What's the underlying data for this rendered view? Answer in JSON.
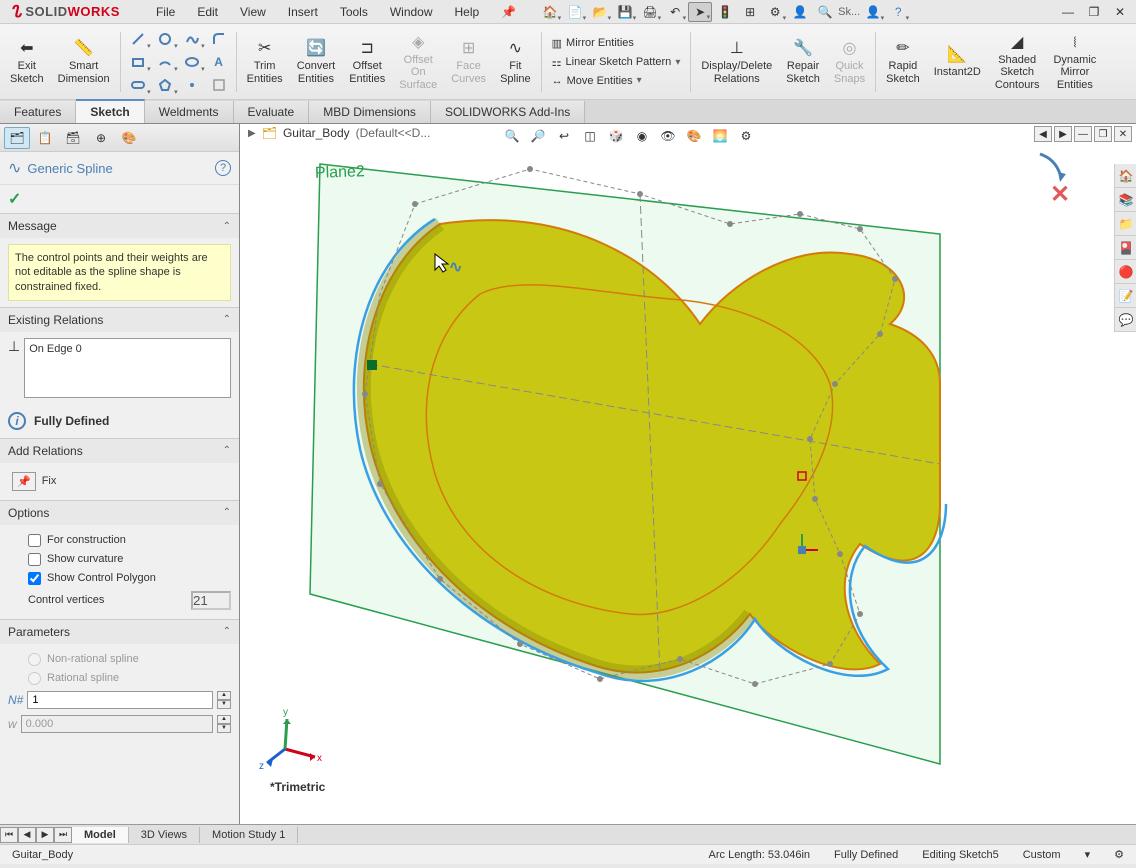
{
  "app": {
    "brand_solid": "SOLID",
    "brand_works": "WORKS",
    "brand_ds": "DS"
  },
  "menu": {
    "file": "File",
    "edit": "Edit",
    "view": "View",
    "insert": "Insert",
    "tools": "Tools",
    "window": "Window",
    "help": "Help"
  },
  "search_label": "Sk...",
  "ribbon": {
    "exit_sketch": "Exit\nSketch",
    "smart_dim": "Smart\nDimension",
    "trim": "Trim\nEntities",
    "convert": "Convert\nEntities",
    "offset": "Offset\nEntities",
    "offset_surf": "Offset\nOn\nSurface",
    "face_curves": "Face\nCurves",
    "fit_spline": "Fit\nSpline",
    "mirror": "Mirror Entities",
    "linear": "Linear Sketch Pattern",
    "move": "Move Entities",
    "display_del": "Display/Delete\nRelations",
    "repair": "Repair\nSketch",
    "quick_snaps": "Quick\nSnaps",
    "rapid": "Rapid\nSketch",
    "instant2d": "Instant2D",
    "shaded": "Shaded\nSketch\nContours",
    "dyn_mirror": "Dynamic\nMirror\nEntities"
  },
  "tabs": {
    "features": "Features",
    "sketch": "Sketch",
    "weldments": "Weldments",
    "evaluate": "Evaluate",
    "mbd": "MBD Dimensions",
    "addins": "SOLIDWORKS Add-Ins"
  },
  "breadcrumb": {
    "part": "Guitar_Body",
    "config": "(Default<<D..."
  },
  "prop": {
    "title": "Generic Spline",
    "msg_head": "Message",
    "msg_body": "The control points and their weights are not editable as the spline shape is constrained fixed.",
    "existing_rel": "Existing Relations",
    "rel_item": "On Edge 0",
    "fully_defined": "Fully Defined",
    "add_rel": "Add Relations",
    "fix": "Fix",
    "options": "Options",
    "for_construction": "For construction",
    "show_curvature": "Show curvature",
    "show_ctrl_poly": "Show Control Polygon",
    "ctrl_vertices": "Control vertices",
    "ctrl_vert_val": "21",
    "parameters": "Parameters",
    "non_rational": "Non-rational spline",
    "rational": "Rational spline",
    "param1": "1",
    "param2": "0.000"
  },
  "plane_label": "Plane2",
  "triad": "*Trimetric",
  "bottom_tabs": {
    "model": "Model",
    "3dviews": "3D Views",
    "motion": "Motion Study 1"
  },
  "status": {
    "left": "Guitar_Body",
    "arc": "Arc Length: 53.046in",
    "defined": "Fully Defined",
    "editing": "Editing Sketch5",
    "units": "Custom"
  }
}
